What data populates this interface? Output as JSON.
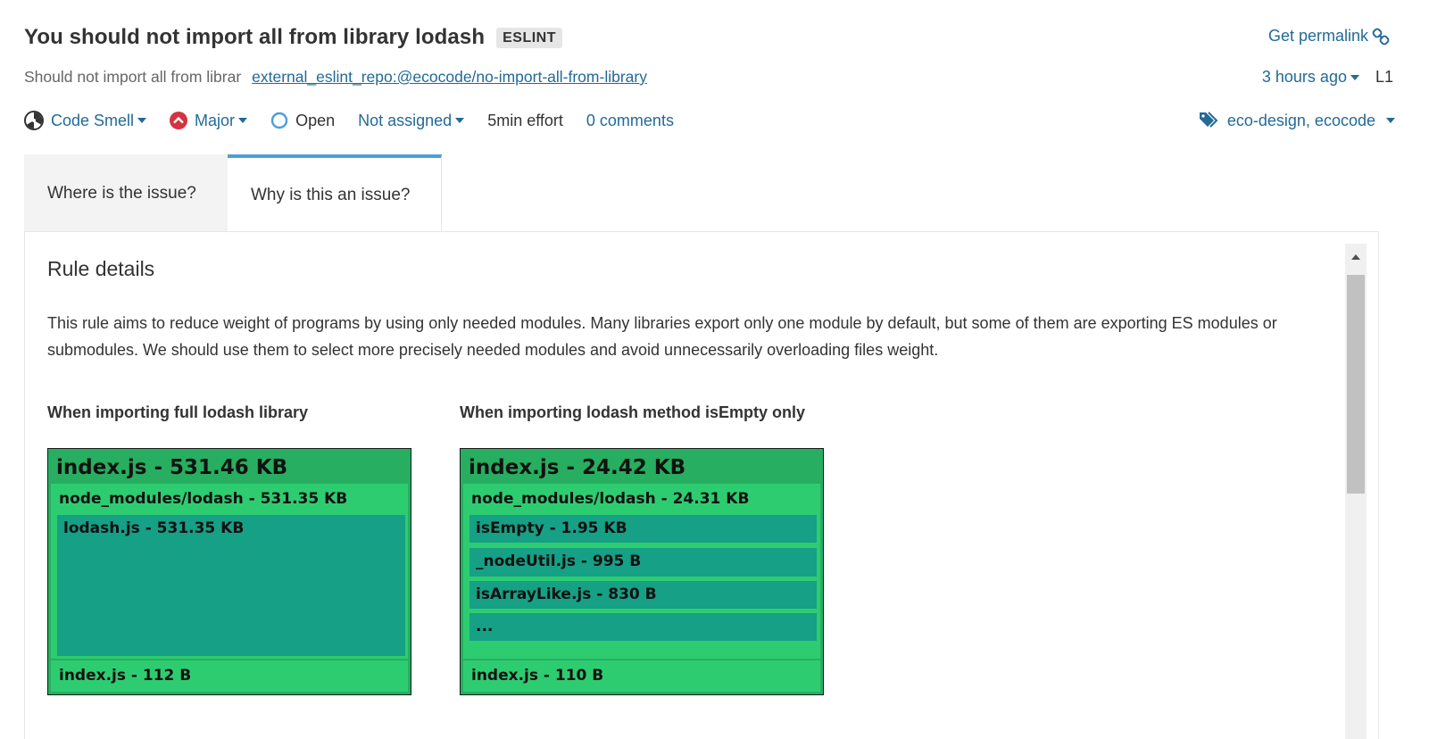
{
  "issue": {
    "title": "You should not import all from library lodash",
    "engine_badge": "ESLINT",
    "permalink_label": "Get permalink",
    "rule_prefix": "Should not import all from librar",
    "rule_key": "external_eslint_repo:@ecocode/no-import-all-from-library",
    "created": "3 hours ago",
    "line": "L1"
  },
  "meta": {
    "type": "Code Smell",
    "severity": "Major",
    "status": "Open",
    "assignee": "Not assigned",
    "effort": "5min effort",
    "comments": "0 comments",
    "tags": "eco-design, ecocode"
  },
  "tabs": [
    {
      "label": "Where is the issue?",
      "active": false
    },
    {
      "label": "Why is this an issue?",
      "active": true
    }
  ],
  "rule": {
    "heading": "Rule details",
    "description": "This rule aims to reduce weight of programs by using only needed modules. Many libraries export only one module by default, but some of them are exporting ES modules or submodules. We should use them to select more precisely needed modules and avoid unnecessarily overloading files weight."
  },
  "figures": [
    {
      "caption": "When importing full lodash library",
      "root": "index.js - 531.46 KB",
      "module": "node_modules/lodash - 531.35 KB",
      "leaves": [
        "lodash.js - 531.35 KB"
      ],
      "footer": "index.js - 112 B"
    },
    {
      "caption": "When importing lodash method isEmpty only",
      "root": "index.js - 24.42 KB",
      "module": "node_modules/lodash - 24.31 KB",
      "leaves": [
        "isEmpty - 1.95 KB",
        "_nodeUtil.js - 995 B",
        "isArrayLike.js - 830 B",
        "..."
      ],
      "footer": "index.js - 110 B"
    }
  ],
  "colors": {
    "link": "#236a97",
    "tab_accent": "#4b9fd5",
    "severity_major": "#d4333f",
    "treemap_root": "#27ae60",
    "treemap_module": "#2ecc71",
    "treemap_leaf": "#16a085"
  },
  "icons": {
    "type": "code-smell-icon",
    "severity": "major-severity-icon",
    "status": "open-status-icon",
    "tags": "tag-icon",
    "permalink": "link-icon"
  }
}
